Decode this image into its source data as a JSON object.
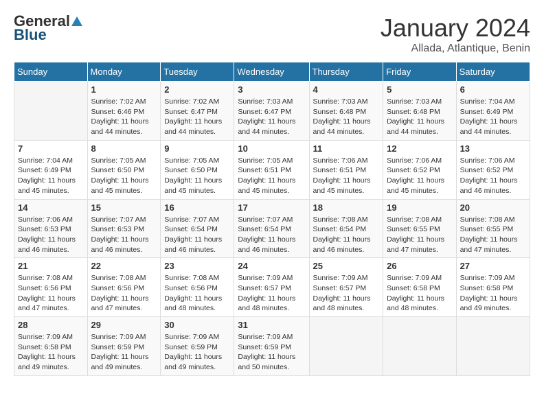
{
  "header": {
    "logo": {
      "general": "General",
      "blue": "Blue"
    },
    "title": "January 2024",
    "location": "Allada, Atlantique, Benin"
  },
  "weekdays": [
    "Sunday",
    "Monday",
    "Tuesday",
    "Wednesday",
    "Thursday",
    "Friday",
    "Saturday"
  ],
  "weeks": [
    [
      {
        "day": "",
        "info": ""
      },
      {
        "day": "1",
        "info": "Sunrise: 7:02 AM\nSunset: 6:46 PM\nDaylight: 11 hours and 44 minutes."
      },
      {
        "day": "2",
        "info": "Sunrise: 7:02 AM\nSunset: 6:47 PM\nDaylight: 11 hours and 44 minutes."
      },
      {
        "day": "3",
        "info": "Sunrise: 7:03 AM\nSunset: 6:47 PM\nDaylight: 11 hours and 44 minutes."
      },
      {
        "day": "4",
        "info": "Sunrise: 7:03 AM\nSunset: 6:48 PM\nDaylight: 11 hours and 44 minutes."
      },
      {
        "day": "5",
        "info": "Sunrise: 7:03 AM\nSunset: 6:48 PM\nDaylight: 11 hours and 44 minutes."
      },
      {
        "day": "6",
        "info": "Sunrise: 7:04 AM\nSunset: 6:49 PM\nDaylight: 11 hours and 44 minutes."
      }
    ],
    [
      {
        "day": "7",
        "info": "Sunrise: 7:04 AM\nSunset: 6:49 PM\nDaylight: 11 hours and 45 minutes."
      },
      {
        "day": "8",
        "info": "Sunrise: 7:05 AM\nSunset: 6:50 PM\nDaylight: 11 hours and 45 minutes."
      },
      {
        "day": "9",
        "info": "Sunrise: 7:05 AM\nSunset: 6:50 PM\nDaylight: 11 hours and 45 minutes."
      },
      {
        "day": "10",
        "info": "Sunrise: 7:05 AM\nSunset: 6:51 PM\nDaylight: 11 hours and 45 minutes."
      },
      {
        "day": "11",
        "info": "Sunrise: 7:06 AM\nSunset: 6:51 PM\nDaylight: 11 hours and 45 minutes."
      },
      {
        "day": "12",
        "info": "Sunrise: 7:06 AM\nSunset: 6:52 PM\nDaylight: 11 hours and 45 minutes."
      },
      {
        "day": "13",
        "info": "Sunrise: 7:06 AM\nSunset: 6:52 PM\nDaylight: 11 hours and 46 minutes."
      }
    ],
    [
      {
        "day": "14",
        "info": "Sunrise: 7:06 AM\nSunset: 6:53 PM\nDaylight: 11 hours and 46 minutes."
      },
      {
        "day": "15",
        "info": "Sunrise: 7:07 AM\nSunset: 6:53 PM\nDaylight: 11 hours and 46 minutes."
      },
      {
        "day": "16",
        "info": "Sunrise: 7:07 AM\nSunset: 6:54 PM\nDaylight: 11 hours and 46 minutes."
      },
      {
        "day": "17",
        "info": "Sunrise: 7:07 AM\nSunset: 6:54 PM\nDaylight: 11 hours and 46 minutes."
      },
      {
        "day": "18",
        "info": "Sunrise: 7:08 AM\nSunset: 6:54 PM\nDaylight: 11 hours and 46 minutes."
      },
      {
        "day": "19",
        "info": "Sunrise: 7:08 AM\nSunset: 6:55 PM\nDaylight: 11 hours and 47 minutes."
      },
      {
        "day": "20",
        "info": "Sunrise: 7:08 AM\nSunset: 6:55 PM\nDaylight: 11 hours and 47 minutes."
      }
    ],
    [
      {
        "day": "21",
        "info": "Sunrise: 7:08 AM\nSunset: 6:56 PM\nDaylight: 11 hours and 47 minutes."
      },
      {
        "day": "22",
        "info": "Sunrise: 7:08 AM\nSunset: 6:56 PM\nDaylight: 11 hours and 47 minutes."
      },
      {
        "day": "23",
        "info": "Sunrise: 7:08 AM\nSunset: 6:56 PM\nDaylight: 11 hours and 48 minutes."
      },
      {
        "day": "24",
        "info": "Sunrise: 7:09 AM\nSunset: 6:57 PM\nDaylight: 11 hours and 48 minutes."
      },
      {
        "day": "25",
        "info": "Sunrise: 7:09 AM\nSunset: 6:57 PM\nDaylight: 11 hours and 48 minutes."
      },
      {
        "day": "26",
        "info": "Sunrise: 7:09 AM\nSunset: 6:58 PM\nDaylight: 11 hours and 48 minutes."
      },
      {
        "day": "27",
        "info": "Sunrise: 7:09 AM\nSunset: 6:58 PM\nDaylight: 11 hours and 49 minutes."
      }
    ],
    [
      {
        "day": "28",
        "info": "Sunrise: 7:09 AM\nSunset: 6:58 PM\nDaylight: 11 hours and 49 minutes."
      },
      {
        "day": "29",
        "info": "Sunrise: 7:09 AM\nSunset: 6:59 PM\nDaylight: 11 hours and 49 minutes."
      },
      {
        "day": "30",
        "info": "Sunrise: 7:09 AM\nSunset: 6:59 PM\nDaylight: 11 hours and 49 minutes."
      },
      {
        "day": "31",
        "info": "Sunrise: 7:09 AM\nSunset: 6:59 PM\nDaylight: 11 hours and 50 minutes."
      },
      {
        "day": "",
        "info": ""
      },
      {
        "day": "",
        "info": ""
      },
      {
        "day": "",
        "info": ""
      }
    ]
  ]
}
